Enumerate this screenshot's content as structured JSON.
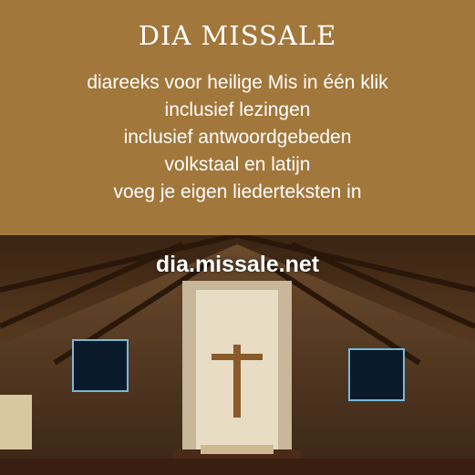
{
  "title": "DIA MISSALE",
  "features": [
    "diareeks voor heilige Mis in één klik",
    "inclusief lezingen",
    "inclusief antwoordgebeden",
    "volkstaal en latijn",
    "voeg je eigen liederteksten in"
  ],
  "url": "dia.missale.net",
  "colors": {
    "background": "#a2773b",
    "text": "#ffffff"
  }
}
